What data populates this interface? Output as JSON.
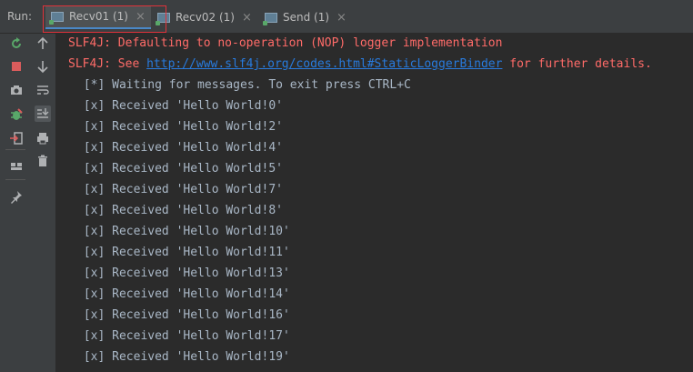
{
  "run_label": "Run:",
  "tabs": [
    {
      "label": "Recv01 (1)",
      "close": "×"
    },
    {
      "label": "Recv02 (1)",
      "close": "×"
    },
    {
      "label": "Send (1)",
      "close": "×"
    }
  ],
  "console": {
    "err1": "SLF4J: Defaulting to no-operation (NOP) logger implementation",
    "err2_prefix": "SLF4J: See ",
    "err2_link": "http://www.slf4j.org/codes.html#StaticLoggerBinder",
    "err2_suffix": " for further details.",
    "lines": [
      " [*] Waiting for messages. To exit press CTRL+C",
      " [x] Received 'Hello World!0'",
      " [x] Received 'Hello World!2'",
      " [x] Received 'Hello World!4'",
      " [x] Received 'Hello World!5'",
      " [x] Received 'Hello World!7'",
      " [x] Received 'Hello World!8'",
      " [x] Received 'Hello World!10'",
      " [x] Received 'Hello World!11'",
      " [x] Received 'Hello World!13'",
      " [x] Received 'Hello World!14'",
      " [x] Received 'Hello World!16'",
      " [x] Received 'Hello World!17'",
      " [x] Received 'Hello World!19'"
    ]
  },
  "icons": {
    "toolbar1": [
      "rerun-icon",
      "stop-icon",
      "camera-icon",
      "debug-icon",
      "exit-icon",
      "layout-icon",
      "pin-icon"
    ],
    "toolbar2": [
      "up-arrow-icon",
      "down-arrow-icon",
      "soft-wrap-icon",
      "scroll-to-end-icon",
      "print-icon",
      "trash-icon"
    ]
  },
  "colors": {
    "background": "#2b2b2b",
    "error_text": "#ff6b68",
    "link": "#287bde",
    "output_text": "#a9b7c6",
    "highlight": "#e0323a"
  }
}
